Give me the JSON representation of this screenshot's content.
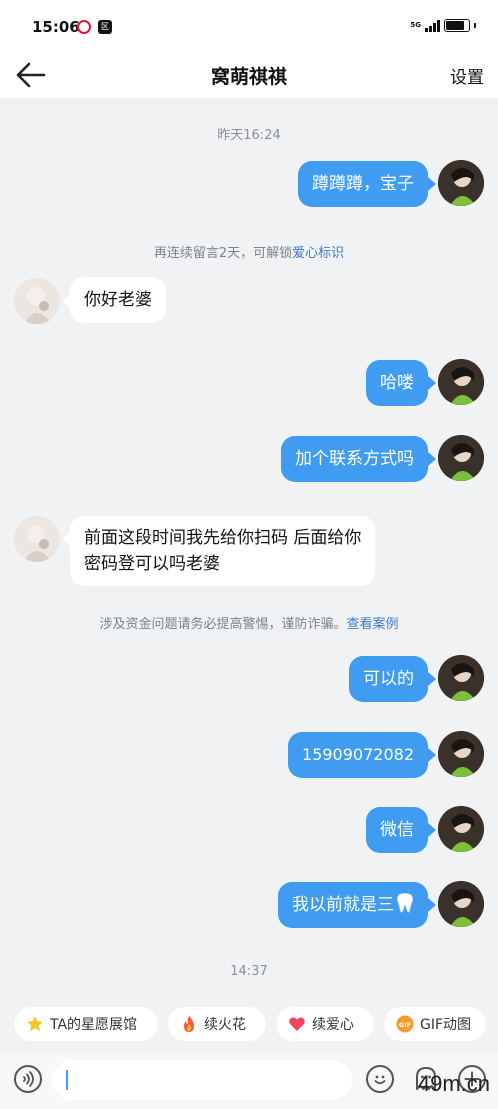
{
  "status_bar": {
    "time": "15:06",
    "network": "5G",
    "app_icon_text": "区"
  },
  "header": {
    "title": "窝萌祺祺",
    "settings": "设置"
  },
  "messages": {
    "ts_1": "昨天16:24",
    "m1": "蹲蹲蹲，宝子",
    "notice_1_prefix": "再连续留言2天，可解锁",
    "notice_1_link": "爱心标识",
    "m2": "你好老婆",
    "m3": "哈喽",
    "m4": "加个联系方式吗",
    "m5_line1": "前面这段时间我先给你扫码 后面给你",
    "m5_line2": "密码登可以吗老婆",
    "notice_2_prefix": "涉及资金问题请务必提高警惕，谨防诈骗。",
    "notice_2_link": "查看案例",
    "m6": "可以的",
    "m7": "15909072082",
    "m8": "微信",
    "m9": "我以前就是三",
    "ts_2": "14:37"
  },
  "quick_actions": {
    "star": "TA的星愿展馆",
    "fire": "续火花",
    "heart": "续爱心",
    "gif": "GIF动图"
  },
  "watermark": "49m.cn",
  "colors": {
    "outgoing_bubble": "#3f9cf0",
    "incoming_bubble": "#ffffff",
    "link": "#3d78c6",
    "background": "#f1f2f4"
  },
  "icons": {
    "back": "arrow-left-icon",
    "voice": "voice-icon",
    "emoji": "smile-icon",
    "sticker": "ghost-icon",
    "plus": "plus-icon",
    "tooth": "tooth-emoji"
  }
}
